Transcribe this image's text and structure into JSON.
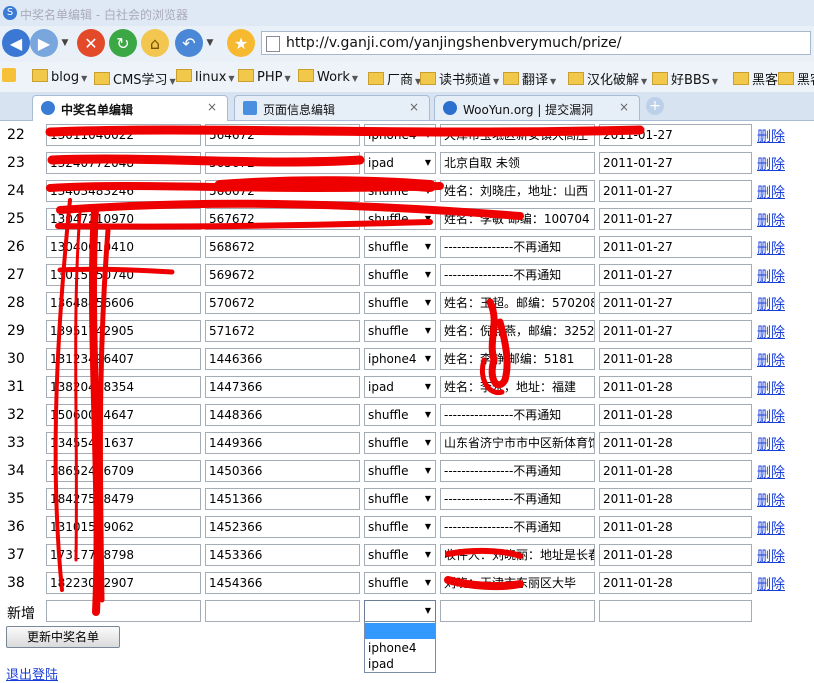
{
  "window": {
    "title": "中奖名单编辑 - 白社会的浏览器"
  },
  "address_bar": {
    "url": "http://v.ganji.com/yanjingshenbverymuch/prize/"
  },
  "bookmarks": [
    "blog",
    "CMS学习",
    "linux",
    "PHP",
    "Work",
    "厂商",
    "读书频道",
    "翻译",
    "汉化破解",
    "好BBS",
    "黑客",
    "黑客"
  ],
  "tabs": [
    {
      "label": "中奖名单编辑",
      "close": "×"
    },
    {
      "label": "页面信息编辑",
      "close": "×"
    },
    {
      "label": "WooYun.org | 提交漏洞",
      "close": "×"
    }
  ],
  "table": {
    "delete_label": "删除",
    "rows": [
      {
        "num": "22",
        "phone": "13011040022",
        "code": "564672",
        "prize": "iphone4",
        "info": "天津市宝坻区新安镇大高庄",
        "date": "2011-01-27"
      },
      {
        "num": "23",
        "phone": "13240772048",
        "code": "565672",
        "prize": "ipad",
        "info": "北京自取  未领",
        "date": "2011-01-27"
      },
      {
        "num": "24",
        "phone": "13403483246",
        "code": "566672",
        "prize": "shuffle",
        "info": "姓名：刘晓庄，地址：山西",
        "date": "2011-01-27"
      },
      {
        "num": "25",
        "phone": "13047210970",
        "code": "567672",
        "prize": "shuffle",
        "info": "姓名：李敏  邮编：100704",
        "date": "2011-01-27"
      },
      {
        "num": "26",
        "phone": "13040010410",
        "code": "568672",
        "prize": "shuffle",
        "info": "----------------不再通知",
        "date": "2011-01-27"
      },
      {
        "num": "27",
        "phone": "13015050740",
        "code": "569672",
        "prize": "shuffle",
        "info": "----------------不再通知",
        "date": "2011-01-27"
      },
      {
        "num": "28",
        "phone": "13648456606",
        "code": "570672",
        "prize": "shuffle",
        "info": "姓名：王超。邮编：570208",
        "date": "2011-01-27"
      },
      {
        "num": "29",
        "phone": "13951742905",
        "code": "571672",
        "prize": "shuffle",
        "info": "姓名：倪燕燕，邮编：3252",
        "date": "2011-01-27"
      },
      {
        "num": "30",
        "phone": "13123496407",
        "code": "1446366",
        "prize": "iphone4",
        "info": "姓名：李静  邮编：5181",
        "date": "2011-01-28"
      },
      {
        "num": "31",
        "phone": "13820478354",
        "code": "1447366",
        "prize": "ipad",
        "info": "姓名：李永，地址：福建",
        "date": "2011-01-28"
      },
      {
        "num": "32",
        "phone": "15060004647",
        "code": "1448366",
        "prize": "shuffle",
        "info": "----------------不再通知",
        "date": "2011-01-28"
      },
      {
        "num": "33",
        "phone": "13455491637",
        "code": "1449366",
        "prize": "shuffle",
        "info": "山东省济宁市市中区新体育馆",
        "date": "2011-01-28"
      },
      {
        "num": "34",
        "phone": "18652456709",
        "code": "1450366",
        "prize": "shuffle",
        "info": "----------------不再通知",
        "date": "2011-01-28"
      },
      {
        "num": "35",
        "phone": "18427538479",
        "code": "1451366",
        "prize": "shuffle",
        "info": "----------------不再通知",
        "date": "2011-01-28"
      },
      {
        "num": "36",
        "phone": "13101559062",
        "code": "1452366",
        "prize": "shuffle",
        "info": "----------------不再通知",
        "date": "2011-01-28"
      },
      {
        "num": "37",
        "phone": "17317778798",
        "code": "1453366",
        "prize": "shuffle",
        "info": "收件人：刘晓丽：地址是长春",
        "date": "2011-01-28"
      },
      {
        "num": "38",
        "phone": "18223012907",
        "code": "1454366",
        "prize": "shuffle",
        "info": "刘晓：天津市东丽区大毕",
        "date": "2011-01-28"
      }
    ]
  },
  "add_row": {
    "label": "新增",
    "prize_options": [
      "",
      "iphone4",
      "ipad"
    ]
  },
  "submit_label": "更新中奖名单",
  "logout_label": "退出登陆",
  "colors": {
    "link": "#1a3fd8",
    "redaction": "#ee0000",
    "select_highlight": "#3399ff"
  }
}
